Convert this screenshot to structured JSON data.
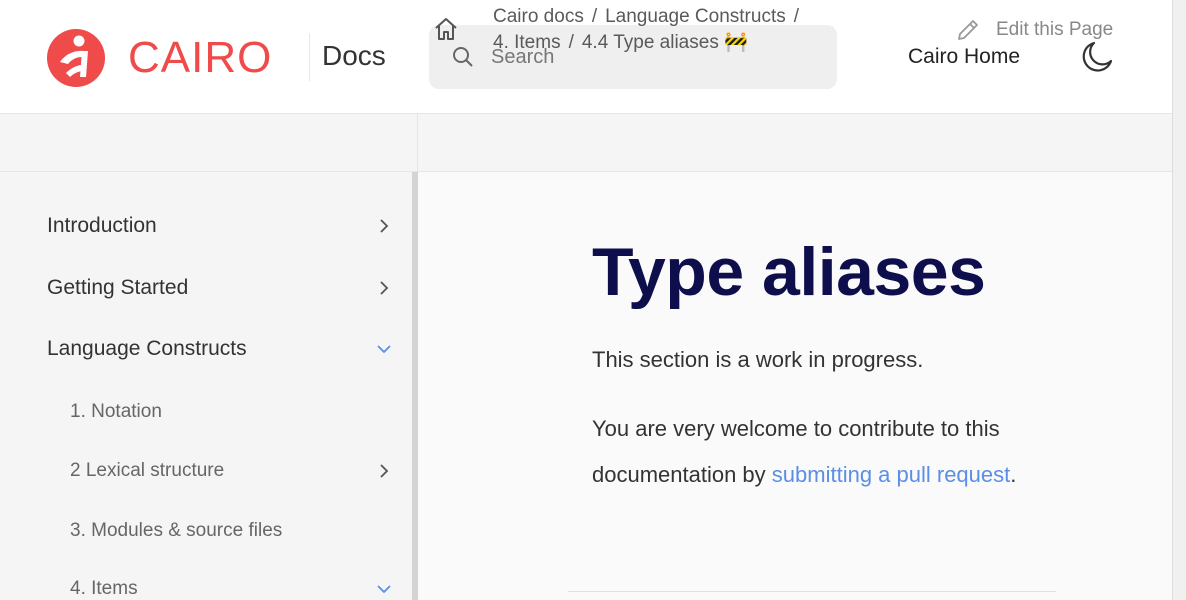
{
  "header": {
    "brand": "CAIRO",
    "docs_label": "Docs",
    "search_placeholder": "Search",
    "cairo_home": "Cairo Home",
    "brand_color": "#ef4b4b"
  },
  "breadcrumb": {
    "items": [
      "Cairo docs",
      "Language Constructs",
      "4. Items",
      "4.4 Type aliases 🚧"
    ],
    "separator": "/"
  },
  "edit_link": "Edit this Page",
  "sidebar": {
    "items": [
      {
        "label": "Introduction",
        "chevron": "right"
      },
      {
        "label": "Getting Started",
        "chevron": "right"
      },
      {
        "label": "Language Constructs",
        "chevron": "down"
      },
      {
        "label": "1. Notation",
        "chevron": ""
      },
      {
        "label": "2 Lexical structure",
        "chevron": "right"
      },
      {
        "label": "3. Modules & source files",
        "chevron": ""
      },
      {
        "label": "4. Items",
        "chevron": "down"
      }
    ]
  },
  "main": {
    "title": "Type aliases",
    "p1": "This section is a work in progress.",
    "p2_before": "You are very welcome to contribute to this documentation by ",
    "p2_link": "submitting a pull request",
    "p2_after": ".",
    "link_color": "#5b8ee6",
    "title_color": "#0e0e4d"
  }
}
